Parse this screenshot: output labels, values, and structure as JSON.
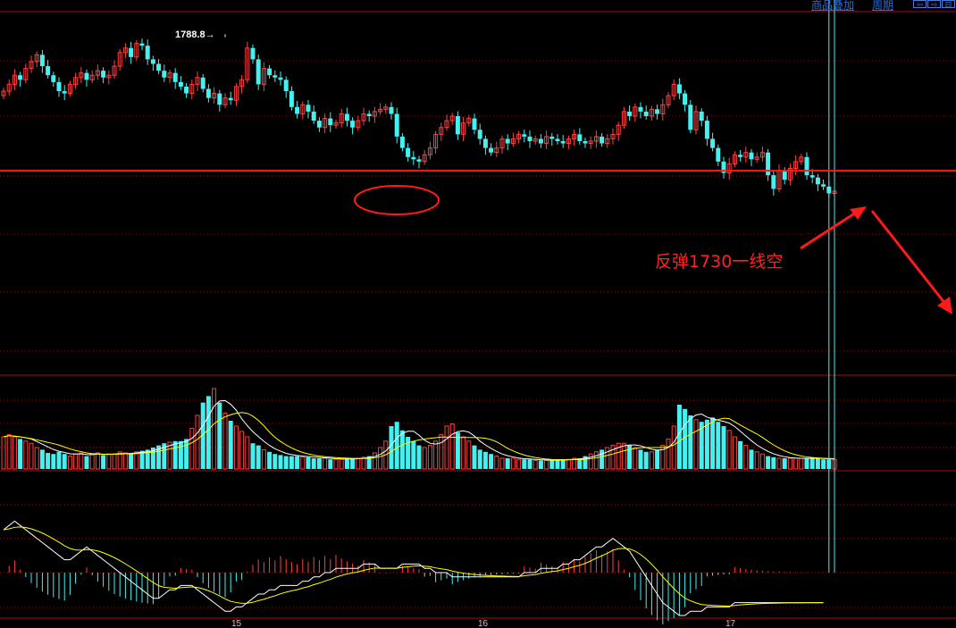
{
  "toolbar": {
    "overlay_label": "商品叠加",
    "period_label": "周期",
    "nav_prev": "⇦",
    "nav_next": "⇨",
    "nav_end": "⊟"
  },
  "chart_data": {
    "type": "candlestick",
    "main_panel": {
      "ylim": [
        1640,
        1800
      ],
      "peak_label": "1788.8→",
      "peak_value": 1788.8,
      "resistance_level": 1730,
      "annotation": "反弹1730一线空",
      "closes": [
        1765,
        1768,
        1772,
        1770,
        1775,
        1778,
        1781,
        1776,
        1772,
        1769,
        1765,
        1764,
        1768,
        1771,
        1773,
        1770,
        1772,
        1774,
        1771,
        1772,
        1776,
        1782,
        1784,
        1780,
        1786,
        1785,
        1779,
        1777,
        1774,
        1771,
        1773,
        1769,
        1767,
        1764,
        1768,
        1771,
        1766,
        1762,
        1764,
        1759,
        1762,
        1761,
        1767,
        1770,
        1784,
        1779,
        1768,
        1775,
        1772,
        1771,
        1770,
        1765,
        1758,
        1755,
        1759,
        1756,
        1752,
        1749,
        1753,
        1750,
        1751,
        1755,
        1752,
        1749,
        1752,
        1755,
        1754,
        1756,
        1757,
        1758,
        1755,
        1745,
        1740,
        1736,
        1735,
        1734,
        1737,
        1740,
        1746,
        1749,
        1752,
        1754,
        1746,
        1751,
        1753,
        1748,
        1744,
        1740,
        1738,
        1740,
        1744,
        1742,
        1744,
        1746,
        1745,
        1743,
        1744,
        1742,
        1745,
        1744,
        1743,
        1742,
        1744,
        1746,
        1743,
        1742,
        1743,
        1745,
        1742,
        1744,
        1746,
        1750,
        1756,
        1754,
        1758,
        1756,
        1754,
        1757,
        1755,
        1759,
        1763,
        1768,
        1764,
        1759,
        1748,
        1756,
        1752,
        1744,
        1740,
        1734,
        1729,
        1733,
        1737,
        1736,
        1738,
        1735,
        1736,
        1738,
        1728,
        1722,
        1730,
        1726,
        1731,
        1734,
        1736,
        1728,
        1727,
        1724,
        1723,
        1720,
        1721
      ],
      "session_labels": [
        "15",
        "16",
        "17"
      ]
    },
    "volume_panel": {
      "values": [
        30,
        32,
        30,
        28,
        26,
        24,
        20,
        18,
        15,
        14,
        16,
        14,
        12,
        14,
        15,
        12,
        14,
        15,
        13,
        14,
        14,
        16,
        15,
        14,
        16,
        17,
        18,
        20,
        22,
        24,
        25,
        26,
        26,
        28,
        38,
        50,
        62,
        68,
        75,
        62,
        52,
        45,
        40,
        35,
        30,
        24,
        22,
        18,
        16,
        14,
        13,
        12,
        12,
        12,
        11,
        11,
        10,
        10,
        10,
        9,
        9,
        9,
        10,
        10,
        10,
        11,
        12,
        15,
        20,
        26,
        40,
        44,
        36,
        30,
        26,
        22,
        20,
        22,
        26,
        32,
        40,
        42,
        34,
        30,
        26,
        22,
        18,
        16,
        14,
        12,
        10,
        10,
        10,
        9,
        9,
        9,
        8,
        8,
        8,
        8,
        9,
        9,
        9,
        10,
        10,
        12,
        14,
        16,
        18,
        20,
        22,
        24,
        24,
        22,
        20,
        18,
        16,
        16,
        18,
        22,
        28,
        40,
        60,
        56,
        50,
        46,
        44,
        46,
        48,
        44,
        40,
        36,
        30,
        26,
        22,
        18,
        16,
        14,
        12,
        11,
        10,
        10,
        10,
        10,
        10,
        10,
        10,
        10,
        9,
        9,
        9
      ]
    },
    "macd_panel": {
      "diff": [
        10,
        11,
        12,
        11,
        10,
        9,
        8,
        7,
        6,
        5,
        4,
        3,
        3,
        4,
        5,
        6,
        5,
        4,
        3,
        2,
        1,
        0,
        -1,
        -2,
        -3,
        -4,
        -5,
        -6,
        -6,
        -5,
        -4,
        -4,
        -3,
        -3,
        -3,
        -4,
        -5,
        -6,
        -7,
        -8,
        -9,
        -9,
        -8,
        -8,
        -7,
        -6,
        -5,
        -5,
        -4,
        -4,
        -3,
        -3,
        -3,
        -3,
        -2,
        -2,
        -1,
        -1,
        0,
        0,
        1,
        1,
        1,
        1,
        1,
        2,
        2,
        2,
        1,
        1,
        1,
        1,
        2,
        2,
        2,
        2,
        1,
        1,
        0,
        0,
        0,
        -1,
        -1,
        -1,
        -1,
        -1,
        -1,
        -1,
        -1,
        -1,
        -1,
        -1,
        -1,
        -1,
        0,
        0,
        0,
        1,
        1,
        1,
        1,
        2,
        2,
        3,
        3,
        4,
        5,
        6,
        6,
        7,
        8,
        7,
        6,
        5,
        3,
        1,
        -1,
        -3,
        -5,
        -7,
        -8,
        -9,
        -10,
        -10,
        -9,
        -9,
        -9,
        -8,
        -8,
        -8,
        -8,
        -8,
        -7,
        -7,
        -7,
        -7,
        -7,
        -7,
        -7,
        -7,
        -7,
        -7,
        -7,
        -7,
        -7,
        -7,
        -7,
        -7,
        -7
      ]
    }
  }
}
